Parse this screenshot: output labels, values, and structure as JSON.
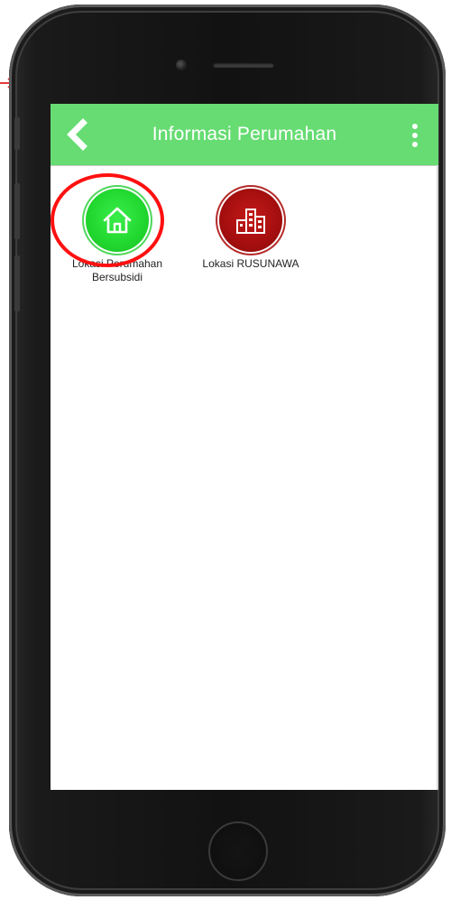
{
  "app_bar": {
    "title": "Informasi Perumahan",
    "color": "#66dc72",
    "back_icon": "chevron-left-icon",
    "menu_icon": "more-vert-icon"
  },
  "menu": {
    "items": [
      {
        "label": "Lokasi Perumahan Bersubsidi",
        "icon": "home-icon",
        "color": "#22d930"
      },
      {
        "label": "Lokasi RUSUNAWA",
        "icon": "buildings-icon",
        "color": "#a40e0e"
      }
    ]
  },
  "annotation": {
    "highlight_color": "#ff1010"
  }
}
